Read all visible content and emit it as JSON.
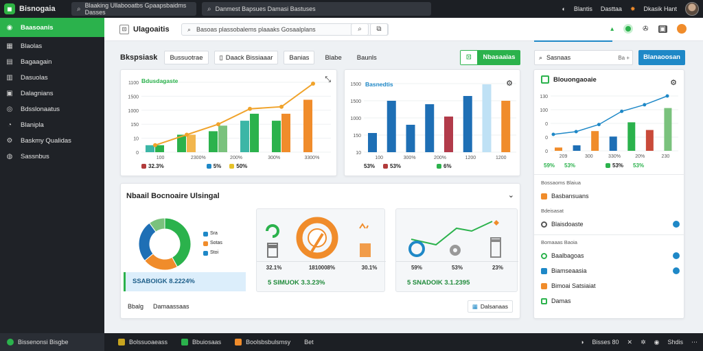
{
  "app": {
    "name": "Bisnogaia",
    "search_left": "Blaaking Ullabooatbs Gpaapsbaidms Dasses",
    "search_right": "Danmest Bapsues Damasi Bastuses",
    "user_items": [
      "Blantis",
      "Dasttaa",
      "Dkasik Hant"
    ]
  },
  "sidebar": {
    "items": [
      {
        "label": "Baasoanis",
        "icon": "dashboard-icon"
      },
      {
        "label": "Blaolas",
        "icon": "grid-icon"
      },
      {
        "label": "Bagaagain",
        "icon": "list-icon"
      },
      {
        "label": "Dasuolas",
        "icon": "table-icon"
      },
      {
        "label": "Dalagnians",
        "icon": "document-icon"
      },
      {
        "label": "Bdsslonaatus",
        "icon": "circle-icon"
      },
      {
        "label": "Blanipla",
        "icon": "chart-icon"
      },
      {
        "label": "Baskmy Qualidas",
        "icon": "settings-icon"
      },
      {
        "label": "Sassnbus",
        "icon": "info-icon"
      }
    ]
  },
  "header": {
    "title": "Ulagoaitis",
    "search_placeholder": "Basoas plassobalems plaaaks Gosaalplans"
  },
  "toolbar": {
    "label": "Bkspsiask",
    "chips": [
      "Bussuotrae",
      "Daack Bissiaaar",
      "Banias",
      "Blabe",
      "Baunls"
    ],
    "primary": "Nbasaaias",
    "right_search": "Sasnaas",
    "right_search_key": "Ba +",
    "blue_button": "Blanaoosan"
  },
  "chart_data": [
    {
      "type": "bar",
      "title": "Bdusdagaste",
      "yticks": [
        "1100",
        "1500",
        "1000",
        "150",
        "10",
        "0"
      ],
      "categories": [
        "100",
        "2300%",
        "200%",
        "300%",
        "3300%"
      ],
      "series": [
        {
          "values": [
            10,
            25,
            30,
            45,
            45,
            75
          ],
          "color": "#2bb24c"
        },
        {
          "values": [
            10,
            25,
            38,
            55,
            55,
            75
          ],
          "color": "#f08c2b"
        }
      ],
      "line": [
        10,
        25,
        40,
        62,
        65,
        98
      ],
      "legend": [
        "32.3%",
        "5%",
        "50%"
      ]
    },
    {
      "type": "bar",
      "title": "Basnedtis",
      "yticks": [
        "1500",
        "1500",
        "1000",
        "150",
        "10"
      ],
      "categories": [
        "100",
        "300%",
        "200%",
        "1200",
        "1200"
      ],
      "values": [
        28,
        75,
        40,
        70,
        52,
        82,
        99,
        75
      ],
      "legend": [
        "53%",
        "53%",
        "6%"
      ]
    },
    {
      "type": "bar",
      "title": "Blouongaoaie",
      "yticks": [
        "130",
        "100",
        "0",
        "0",
        "0"
      ],
      "categories": [
        "209",
        "300",
        "330%",
        "20%",
        "230"
      ],
      "line": [
        30,
        35,
        48,
        72,
        84,
        100
      ],
      "legend": [
        "59%",
        "53%",
        "53%",
        "53%"
      ]
    },
    {
      "type": "pie",
      "title": "Nbaail Bocnoaire Ulsingal",
      "slices": [
        42,
        22,
        26,
        10
      ],
      "legend": [
        "Sra",
        "Sotas",
        "Stoi"
      ]
    }
  ],
  "overview": {
    "title": "Nbaail Bocnoaire Ulsingal",
    "highlight": "SSABOIGK 8.2224%",
    "card2_stats": [
      "32.1%",
      "1810008%",
      "30.1%"
    ],
    "card2_total": "5 SIMUOK 3.3.23%",
    "card3_stats": [
      "59%",
      "53%",
      "23%"
    ],
    "card3_total": "5 SNADOIK 3.1.2395",
    "footer_left": [
      "Bbalg",
      "Damaassaas"
    ],
    "footer_right": "Dalsanaas"
  },
  "right_panel": {
    "section1": "Bossaoms Blaiua",
    "items1": [
      "Basbansuans"
    ],
    "section2": "Bdeisasat",
    "items2": [
      "Blaisdoaste"
    ],
    "section3": "Bomaaas Baoia",
    "items3": [
      "Baalbagoas",
      "Biamseaasia",
      "Bimoai Satsiaiat",
      "Damas"
    ]
  },
  "taskbar": {
    "items": [
      "Bissenonsi Bisgbe",
      "Bolssuoaeass",
      "Bbuiosaas",
      "Boolsbsbulsmsy",
      "Bet"
    ],
    "right": [
      "Bisses 80",
      "Shdis"
    ]
  }
}
